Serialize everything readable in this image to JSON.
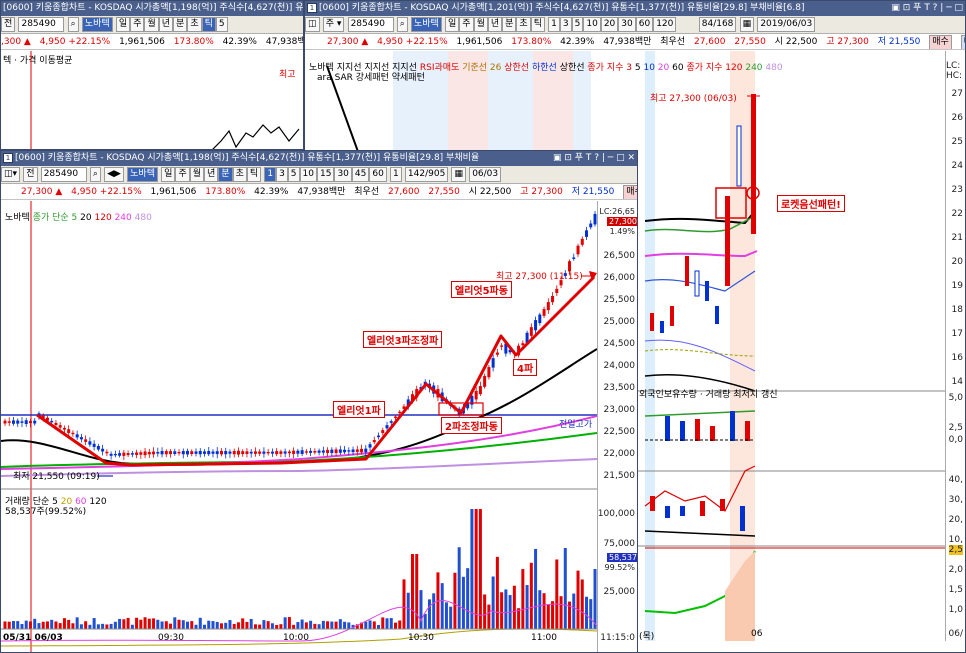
{
  "back_window": {
    "title": "[0600] 키움종합차트 - KOSDAQ 시가총액[1,201(억)] 주식수[4,627(천)] 유통수[1,377(천)] 유통비율[29.8] 부채비율[6.8]",
    "toolbar": {
      "code": "285490",
      "name": "노바텍",
      "periods": [
        "일",
        "주",
        "월",
        "년",
        "분",
        "초",
        "틱"
      ],
      "minutes": [
        "1",
        "3",
        "5",
        "10",
        "20",
        "30",
        "60",
        "120"
      ],
      "count": "84/168",
      "date": "2019/06/03"
    },
    "quote": {
      "price": "27,300 ▲",
      "change": "4,950 +22.15%",
      "volume": "1,961,506",
      "turnover": "173.80%",
      "ratio": "42.39%",
      "amount": "47,938백만",
      "bid_label": "최우선",
      "bid1": "27,600",
      "bid2": "27,550",
      "open": "시 22,500",
      "high": "고 27,300",
      "low": "저 21,550",
      "buy": "매수",
      "sell": "매도"
    },
    "legend": {
      "stock": "노바텍",
      "items": [
        "지지선",
        "지지선",
        "지지선",
        "RSI과매도",
        "기준선 26",
        "상한선",
        "하한선",
        "상한선"
      ],
      "ma_label": "종가 지수 3",
      "ma_vals": [
        "5",
        "10",
        "20",
        "60"
      ],
      "ma2_label": "종가 지수 120",
      "ma2_vals": [
        "240",
        "480"
      ],
      "sub": "ara SAR 강세패턴  약세패턴",
      "right": "LC:\nHC:"
    },
    "high_label": "최고 27,300 (06/03)",
    "annotation": "로켓음선패턴!",
    "ticks": [
      "27",
      "26",
      "25",
      "24",
      "23",
      "22",
      "21",
      "20",
      "19",
      "18",
      "17",
      "16",
      "15",
      "14"
    ],
    "sub_legend": "외국인보유수량 · 거래량 최저치 갱신",
    "sub_ticks": [
      "5,0",
      "2,5",
      "0,0",
      "40,",
      "30,",
      "20,",
      "10,",
      "2,5",
      "2,0",
      "1,5",
      "1,0"
    ],
    "xlabel_left": "(목)",
    "xlabel_right": "06",
    "xlabel_far": "06/"
  },
  "left_back_window": {
    "title": "[0600] 키움종합차트 - KOSDAQ 시가총액[1,198(억)] 주식수[4,627(천)] 유",
    "toolbar": {
      "prev": "전",
      "code": "285490",
      "name": "노바텍",
      "periods": [
        "일",
        "주",
        "월",
        "년",
        "분",
        "초",
        "틱"
      ],
      "extra": "5"
    },
    "quote": {
      "price": ",300 ▲",
      "change": "4,950 +22.15%",
      "volume": "1,961,506",
      "turnover": "173.80%",
      "ratio": "42.39%",
      "amount": "47,938백만"
    },
    "legend": "텍 · 가격 이동평균",
    "corner": "최고"
  },
  "front_window": {
    "title": "[0600] 키움종합차트 - KOSDAQ 시가총액[1,198(억)] 주식수[4,627(천)] 유통수[1,377(천)] 유통비율[29.8] 부채비율",
    "toolbar": {
      "prev": "전",
      "code": "285490",
      "name": "노바텍",
      "periods": [
        "일",
        "주",
        "월",
        "년",
        "분",
        "초",
        "틱"
      ],
      "minutes": [
        "1",
        "3",
        "5",
        "10",
        "15",
        "30",
        "45",
        "60"
      ],
      "unit": "1",
      "count": "142/905",
      "date": "06/03"
    },
    "quote": {
      "price": "27,300 ▲",
      "change": "4,950 +22.15%",
      "volume": "1,961,506",
      "turnover": "173.80%",
      "ratio": "42.39%",
      "amount": "47,938백만",
      "bid_label": "최우선",
      "bid1": "27,600",
      "bid2": "27,550",
      "open": "시 22,500",
      "high": "고 27,300",
      "low": "저 21,550",
      "buy": "매수",
      "sell": "매도"
    },
    "legend": {
      "stock": "노바텍",
      "ma_label": "종가 단순 5",
      "ma_vals": [
        "20",
        "120",
        "240",
        "480"
      ]
    },
    "high_label": "최고 27,300 (11:15)",
    "low_label": "최저 21,550 (09:19)",
    "prev_high": "전일고가",
    "annotations": {
      "wave1": "엘리엇1파",
      "wave2": "2파조정파동",
      "wave3": "엘리엇3파조정파",
      "wave4": "4파",
      "wave5": "엘리엇5파동"
    },
    "price_axis": [
      "26,500",
      "26,000",
      "25,500",
      "25,000",
      "24,500",
      "24,000",
      "23,500",
      "23,000",
      "22,500",
      "22,000",
      "21,500"
    ],
    "axis_top": [
      "LC:26,65",
      "27,300",
      "1.49%"
    ],
    "volume_legend": {
      "label": "거래량 단순 5",
      "vals": [
        "20",
        "60",
        "120"
      ],
      "current": "58,537주(99.52%)"
    },
    "volume_axis": [
      "100,000",
      "75,000",
      "50,000",
      "25,000"
    ],
    "volume_box": [
      "58,537",
      "99.52%"
    ],
    "time_axis": [
      "05/31 06/03",
      "09:30",
      "10:00",
      "10:30",
      "11:00",
      "11:15:0"
    ]
  },
  "chart_data": [
    {
      "type": "line",
      "title": "",
      "xlabel": "",
      "ylabel": "",
      "x": [
        "09:00",
        "09:19",
        "09:30",
        "10:00",
        "10:20",
        "10:28",
        "10:33",
        "10:38",
        "10:45",
        "10:50",
        "11:00",
        "11:15"
      ],
      "series": [
        {
          "name": "",
          "values": [
            22850,
            21900,
            21950,
            21950,
            22000,
            23550,
            22850,
            23400,
            24400,
            24200,
            25400,
            27300
          ]
        }
      ],
      "ylim": [
        21300,
        26800
      ],
      "grid": false
    }
  ],
  "colors": {
    "title_bg": "#4a5f8c",
    "up": "#e00000",
    "down": "#0030d0",
    "annotation": "#e00000"
  }
}
